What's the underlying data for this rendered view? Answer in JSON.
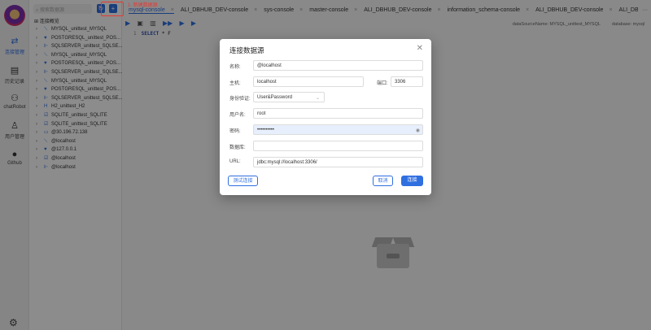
{
  "nav": {
    "items": [
      {
        "label": "连接管理",
        "icon": "database-link-icon"
      },
      {
        "label": "历史记录",
        "icon": "history-icon"
      },
      {
        "label": "chatRobot",
        "icon": "robot-icon"
      },
      {
        "label": "用户管理",
        "icon": "user-manage-icon"
      },
      {
        "label": "Github",
        "icon": "github-icon"
      }
    ],
    "settings_icon": "gear-icon"
  },
  "tree": {
    "search_placeholder": "搜索数据源",
    "header": "连接概览",
    "items": [
      {
        "label": "MYSQL_unittest_MYSQL",
        "type": "mysql"
      },
      {
        "label": "POSTGRESQL_unittest_POS...",
        "type": "postgresql"
      },
      {
        "label": "SQLSERVER_unittest_SQLSE...",
        "type": "sqlserver"
      },
      {
        "label": "MYSQL_unittest_MYSQL",
        "type": "mysql"
      },
      {
        "label": "POSTGRESQL_unittest_POS...",
        "type": "postgresql"
      },
      {
        "label": "SQLSERVER_unittest_SQLSE...",
        "type": "sqlserver"
      },
      {
        "label": "MYSQL_unittest_MYSQL",
        "type": "mysql"
      },
      {
        "label": "POSTGRESQL_unittest_POS...",
        "type": "postgresql"
      },
      {
        "label": "SQLSERVER_unittest_SQLSE...",
        "type": "sqlserver"
      },
      {
        "label": "H2_unittest_H2",
        "type": "h2"
      },
      {
        "label": "SQLITE_unittest_SQLITE",
        "type": "sqlite"
      },
      {
        "label": "SQLITE_unittest_SQLITE",
        "type": "sqlite"
      },
      {
        "label": "@30.196.72.138",
        "type": "oracle"
      },
      {
        "label": "@localhost",
        "type": "mysql"
      },
      {
        "label": "@127.0.0.1",
        "type": "postgresql"
      },
      {
        "label": "@localhost",
        "type": "sqlite"
      },
      {
        "label": "@localhost",
        "type": "sqlserver"
      }
    ]
  },
  "annotation": "1. 新建数据源",
  "tabs": [
    {
      "label": "mysql-console",
      "active": true
    },
    {
      "label": "ALI_DBHUB_DEV-console"
    },
    {
      "label": "sys-console"
    },
    {
      "label": "master-console"
    },
    {
      "label": "ALI_DBHUB_DEV-console"
    },
    {
      "label": "information_schema-console"
    },
    {
      "label": "ALI_DBHUB_DEV-console"
    },
    {
      "label": "ALI_DBH"
    }
  ],
  "meta": {
    "datasource": "dataSourceName: MYSQL_unittest_MYSQL",
    "database": "database: mysql"
  },
  "editor": {
    "line": "1",
    "keyword": "SELECT",
    "rest": " * F"
  },
  "modal": {
    "title": "连接数据源",
    "fields": {
      "name_label": "名称:",
      "name": "@localhost",
      "host_label": "主机:",
      "host": "localhost",
      "port_label": "端口:",
      "port": "3306",
      "auth_label": "身份验证:",
      "auth": "User&Password",
      "user_label": "用户名:",
      "user": "root",
      "password_label": "密码:",
      "password": "••••••••••",
      "database_label": "数据库:",
      "database": "",
      "url_label": "URL:",
      "url": "jdbc:mysql://localhost:3306/"
    },
    "test_button": "测试连接",
    "cancel_button": "取消",
    "connect_button": "连接"
  },
  "colors": {
    "accent": "#2f6fe0",
    "annotation": "#e53935"
  }
}
